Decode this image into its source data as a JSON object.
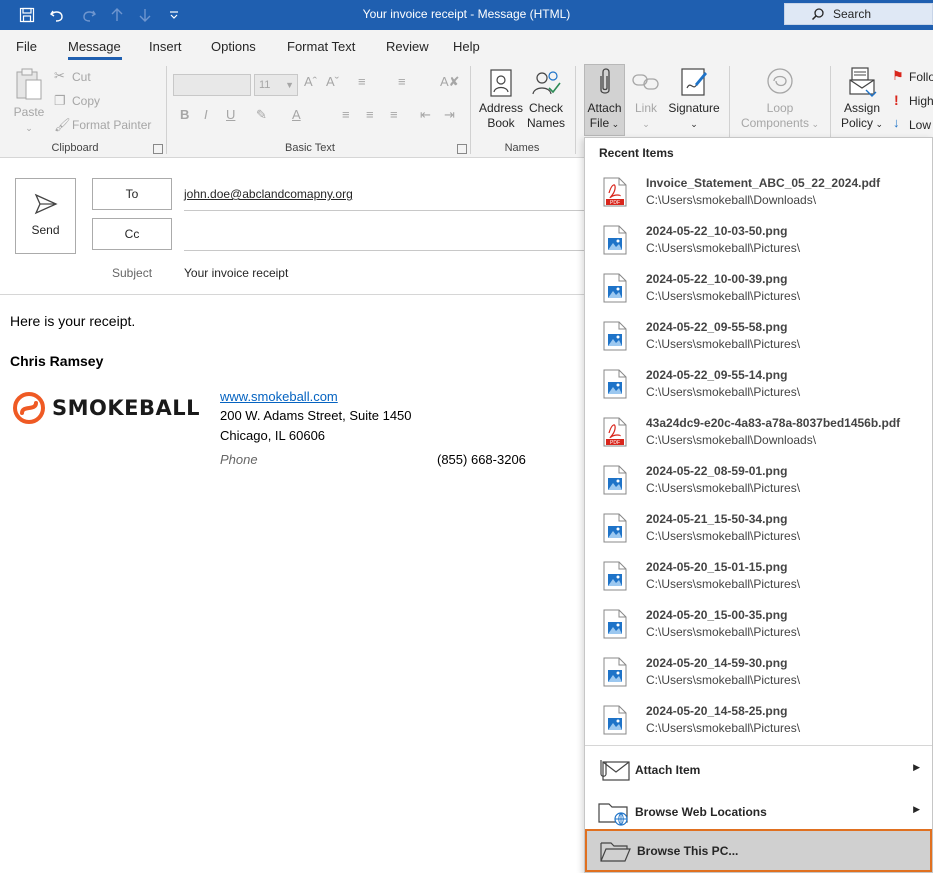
{
  "window": {
    "title": "Your invoice receipt  -  Message (HTML)",
    "search_label": "Search"
  },
  "tabs": [
    "File",
    "Message",
    "Insert",
    "Options",
    "Format Text",
    "Review",
    "Help"
  ],
  "ribbon": {
    "clipboard": {
      "label": "Clipboard",
      "paste": "Paste",
      "cut": "Cut",
      "copy": "Copy",
      "format_painter": "Format Painter"
    },
    "basic_text": {
      "label": "Basic Text",
      "font_size": "11",
      "bold": "B",
      "italic": "I",
      "underline": "U"
    },
    "names": {
      "label": "Names",
      "address_book": [
        "Address",
        "Book"
      ],
      "check_names": [
        "Check",
        "Names"
      ]
    },
    "include": {
      "attach_file": [
        "Attach",
        "File"
      ],
      "link": "Link",
      "signature": "Signature"
    },
    "loop": {
      "label": [
        "Loop",
        "Components"
      ]
    },
    "tags": {
      "assign_policy": [
        "Assign",
        "Policy"
      ],
      "follow": "Follo",
      "high": "High",
      "low": "Low"
    }
  },
  "compose": {
    "send": "Send",
    "to_label": "To",
    "cc_label": "Cc",
    "to_value": "john.doe@abclandcomapny.org",
    "subject_label": "Subject",
    "subject_value": "Your invoice receipt",
    "body_line": "Here is your receipt.",
    "signature": {
      "name": "Chris Ramsey",
      "company": "SMOKEBALL",
      "website": "www.smokeball.com",
      "address1": "200 W. Adams Street, Suite 1450",
      "address2": "Chicago, IL 60606",
      "phone_label": "Phone",
      "phone_value": "(855) 668-3206"
    }
  },
  "attach_menu": {
    "heading": "Recent Items",
    "items": [
      {
        "name": "Invoice_Statement_ABC_05_22_2024.pdf",
        "path": "C:\\Users\\smokeball\\Downloads\\",
        "type": "pdf"
      },
      {
        "name": "2024-05-22_10-03-50.png",
        "path": "C:\\Users\\smokeball\\Pictures\\",
        "type": "png"
      },
      {
        "name": "2024-05-22_10-00-39.png",
        "path": "C:\\Users\\smokeball\\Pictures\\",
        "type": "png"
      },
      {
        "name": "2024-05-22_09-55-58.png",
        "path": "C:\\Users\\smokeball\\Pictures\\",
        "type": "png"
      },
      {
        "name": "2024-05-22_09-55-14.png",
        "path": "C:\\Users\\smokeball\\Pictures\\",
        "type": "png"
      },
      {
        "name": "43a24dc9-e20c-4a83-a78a-8037bed1456b.pdf",
        "path": "C:\\Users\\smokeball\\Downloads\\",
        "type": "pdf"
      },
      {
        "name": "2024-05-22_08-59-01.png",
        "path": "C:\\Users\\smokeball\\Pictures\\",
        "type": "png"
      },
      {
        "name": "2024-05-21_15-50-34.png",
        "path": "C:\\Users\\smokeball\\Pictures\\",
        "type": "png"
      },
      {
        "name": "2024-05-20_15-01-15.png",
        "path": "C:\\Users\\smokeball\\Pictures\\",
        "type": "png"
      },
      {
        "name": "2024-05-20_15-00-35.png",
        "path": "C:\\Users\\smokeball\\Pictures\\",
        "type": "png"
      },
      {
        "name": "2024-05-20_14-59-30.png",
        "path": "C:\\Users\\smokeball\\Pictures\\",
        "type": "png"
      },
      {
        "name": "2024-05-20_14-58-25.png",
        "path": "C:\\Users\\smokeball\\Pictures\\",
        "type": "png"
      }
    ],
    "actions": {
      "attach_item": "Attach Item",
      "browse_web": "Browse Web Locations",
      "browse_pc": "Browse This PC..."
    }
  },
  "colors": {
    "titlebar": "#1f5fb0",
    "accent": "#1f5fb0",
    "highlight_border": "#e07020",
    "pdf_red": "#d9261c",
    "image_blue": "#1e73c8",
    "logo_orange": "#ef5a24"
  }
}
